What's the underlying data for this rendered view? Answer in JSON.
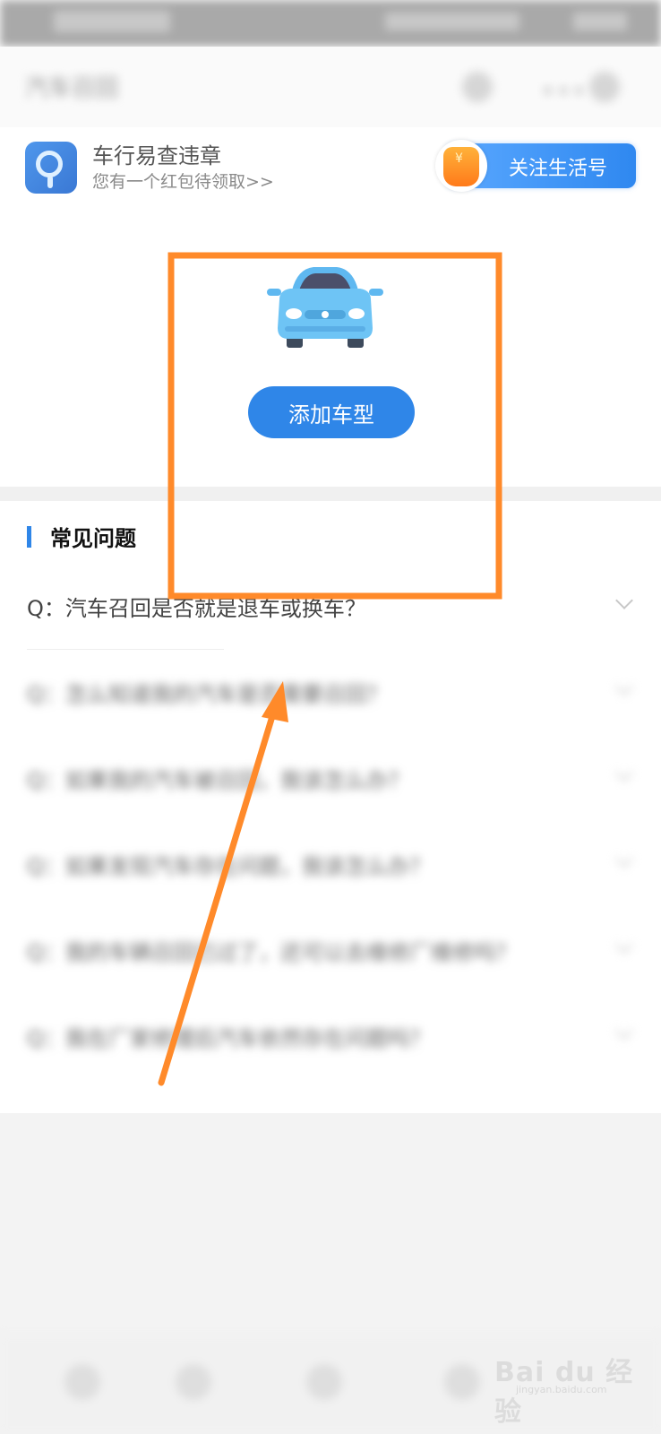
{
  "nav": {
    "title": "汽车召回"
  },
  "service": {
    "app_name": "车行易查违章",
    "subtitle": "您有一个红包待领取>>",
    "follow_label": "关注生活号",
    "coin_symbol": "¥"
  },
  "hero": {
    "add_button": "添加车型"
  },
  "faq": {
    "title": "常见问题",
    "items": [
      {
        "q": "Q：汽车召回是否就是退车或换车？",
        "blurred": false
      },
      {
        "q": "Q：怎么知道我的汽车是否需要召回？",
        "blurred": true
      },
      {
        "q": "Q：如果我的汽车被召回，我该怎么办？",
        "blurred": true
      },
      {
        "q": "Q：如果发现汽车存在问题，我该怎么办？",
        "blurred": true
      },
      {
        "q": "Q：我的车辆召回已过了，还可以去维修厂维修吗？",
        "blurred": true
      },
      {
        "q": "Q：我在厂家修理后汽车依然存在问题吗？",
        "blurred": true
      }
    ]
  },
  "watermark": {
    "main": "Bai du 经验",
    "sub": "jingyan.baidu.com"
  },
  "colors": {
    "accent": "#2f86e8",
    "annotation": "#ff8a2a"
  }
}
